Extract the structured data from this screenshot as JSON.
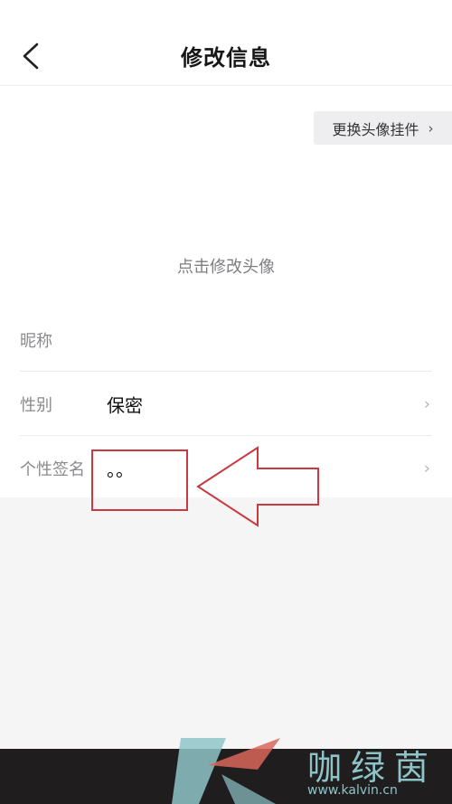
{
  "header": {
    "title": "修改信息",
    "back_icon": "chevron-left-icon"
  },
  "pendant": {
    "label": "更换头像挂件",
    "chevron": "›"
  },
  "avatar": {
    "hint": "点击修改头像"
  },
  "fields": [
    {
      "label": "昵称",
      "value": ""
    },
    {
      "label": "性别",
      "value": "保密",
      "chevron": "›"
    },
    {
      "label": "个性签名",
      "value": "。。",
      "chevron": "›"
    }
  ],
  "watermark": {
    "text": "咖绿茵",
    "url": "www.kalvin.cn"
  },
  "colors": {
    "annotation": "#c9393f",
    "watermark": "#8ec4c8"
  }
}
